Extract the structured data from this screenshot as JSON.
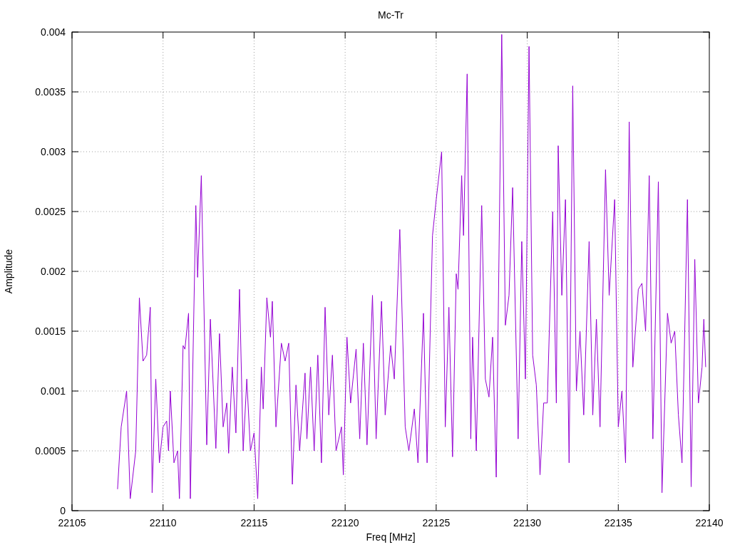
{
  "chart_data": {
    "type": "line",
    "grid": true,
    "title": "Mc-Tr",
    "xlabel": "Freq [MHz]",
    "ylabel": "Amplitude",
    "xlim": [
      22105,
      22140
    ],
    "ylim": [
      0,
      0.004
    ],
    "xticks": [
      22105,
      22110,
      22115,
      22120,
      22125,
      22130,
      22135,
      22140
    ],
    "yticks": [
      {
        "value": 0,
        "label": "0"
      },
      {
        "value": 0.0005,
        "label": "0.0005"
      },
      {
        "value": 0.001,
        "label": "0.001"
      },
      {
        "value": 0.0015,
        "label": "0.0015"
      },
      {
        "value": 0.002,
        "label": "0.002"
      },
      {
        "value": 0.0025,
        "label": "0.0025"
      },
      {
        "value": 0.003,
        "label": "0.003"
      },
      {
        "value": 0.0035,
        "label": "0.0035"
      },
      {
        "value": 0.004,
        "label": "0.004"
      }
    ],
    "x": [
      22107.5,
      22107.7,
      22108.0,
      22108.2,
      22108.5,
      22108.7,
      22108.9,
      22109.1,
      22109.3,
      22109.4,
      22109.6,
      22109.8,
      22110.0,
      22110.2,
      22110.3,
      22110.4,
      22110.6,
      22110.8,
      22110.9,
      22111.1,
      22111.2,
      22111.4,
      22111.5,
      22111.8,
      22111.9,
      22112.1,
      22112.4,
      22112.6,
      22112.9,
      22113.1,
      22113.3,
      22113.5,
      22113.6,
      22113.8,
      22114.0,
      22114.2,
      22114.4,
      22114.6,
      22114.8,
      22115.0,
      22115.2,
      22115.4,
      22115.5,
      22115.7,
      22115.9,
      22116.0,
      22116.2,
      22116.5,
      22116.7,
      22116.9,
      22117.1,
      22117.3,
      22117.5,
      22117.8,
      22117.9,
      22118.1,
      22118.3,
      22118.5,
      22118.7,
      22118.9,
      22119.1,
      22119.3,
      22119.5,
      22119.8,
      22119.9,
      22120.1,
      22120.3,
      22120.6,
      22120.8,
      22121.0,
      22121.2,
      22121.5,
      22121.7,
      22122.0,
      22122.2,
      22122.5,
      22122.7,
      22123.0,
      22123.3,
      22123.5,
      22123.8,
      22124.0,
      22124.3,
      22124.5,
      22124.8,
      22125.0,
      22125.3,
      22125.5,
      22125.7,
      22125.9,
      22126.1,
      22126.2,
      22126.4,
      22126.5,
      22126.7,
      22126.9,
      22127.0,
      22127.2,
      22127.5,
      22127.7,
      22127.9,
      22128.1,
      22128.3,
      22128.6,
      22128.8,
      22129.0,
      22129.2,
      22129.5,
      22129.7,
      22129.9,
      22130.1,
      22130.3,
      22130.5,
      22130.7,
      22130.9,
      22131.1,
      22131.4,
      22131.6,
      22131.7,
      22131.9,
      22132.1,
      22132.3,
      22132.5,
      22132.7,
      22132.9,
      22133.1,
      22133.4,
      22133.6,
      22133.8,
      22134.0,
      22134.3,
      22134.5,
      22134.8,
      22135.0,
      22135.2,
      22135.4,
      22135.6,
      22135.8,
      22136.1,
      22136.3,
      22136.5,
      22136.7,
      22136.9,
      22137.2,
      22137.4,
      22137.7,
      22137.9,
      22138.1,
      22138.3,
      22138.5,
      22138.8,
      22139.0,
      22139.2,
      22139.4,
      22139.6,
      22139.7,
      22139.8
    ],
    "series": [
      {
        "color": "#9400d3",
        "values": [
          0.00018,
          0.0007,
          0.001,
          0.0001,
          0.0005,
          0.00178,
          0.00125,
          0.0013,
          0.0017,
          0.00015,
          0.0011,
          0.0004,
          0.0007,
          0.00075,
          0.0005,
          0.001,
          0.0004,
          0.0005,
          0.0001,
          0.00138,
          0.00135,
          0.00165,
          0.0001,
          0.00255,
          0.00195,
          0.0028,
          0.00055,
          0.0016,
          0.00052,
          0.00148,
          0.0007,
          0.0009,
          0.00048,
          0.0012,
          0.00065,
          0.00185,
          0.0005,
          0.0011,
          0.0005,
          0.00065,
          0.0001,
          0.0012,
          0.00085,
          0.00178,
          0.00145,
          0.00175,
          0.0007,
          0.0014,
          0.00125,
          0.0014,
          0.00022,
          0.00105,
          0.0005,
          0.00115,
          0.0006,
          0.0012,
          0.0005,
          0.0013,
          0.0004,
          0.0017,
          0.0008,
          0.0013,
          0.0005,
          0.0007,
          0.0003,
          0.00145,
          0.0009,
          0.00135,
          0.0006,
          0.0014,
          0.00055,
          0.0018,
          0.0006,
          0.00175,
          0.0008,
          0.00138,
          0.0011,
          0.00235,
          0.0007,
          0.0005,
          0.00085,
          0.0004,
          0.00165,
          0.0004,
          0.0023,
          0.0026,
          0.003,
          0.0007,
          0.0017,
          0.00045,
          0.00198,
          0.00185,
          0.0028,
          0.0023,
          0.00365,
          0.0006,
          0.00145,
          0.0005,
          0.00255,
          0.0011,
          0.00095,
          0.00145,
          0.00028,
          0.00398,
          0.00155,
          0.0018,
          0.0027,
          0.0006,
          0.00225,
          0.0011,
          0.00388,
          0.0013,
          0.00105,
          0.0003,
          0.0009,
          0.0009,
          0.0025,
          0.0009,
          0.00305,
          0.0018,
          0.0026,
          0.0004,
          0.00355,
          0.001,
          0.0015,
          0.0008,
          0.00225,
          0.0008,
          0.0016,
          0.0007,
          0.00285,
          0.0018,
          0.0026,
          0.0007,
          0.001,
          0.0004,
          0.00325,
          0.0012,
          0.00185,
          0.0019,
          0.0015,
          0.0028,
          0.0006,
          0.00275,
          0.00015,
          0.00165,
          0.0014,
          0.0015,
          0.0008,
          0.0004,
          0.0026,
          0.0002,
          0.0021,
          0.0009,
          0.0012,
          0.0016,
          0.0012
        ]
      }
    ]
  }
}
